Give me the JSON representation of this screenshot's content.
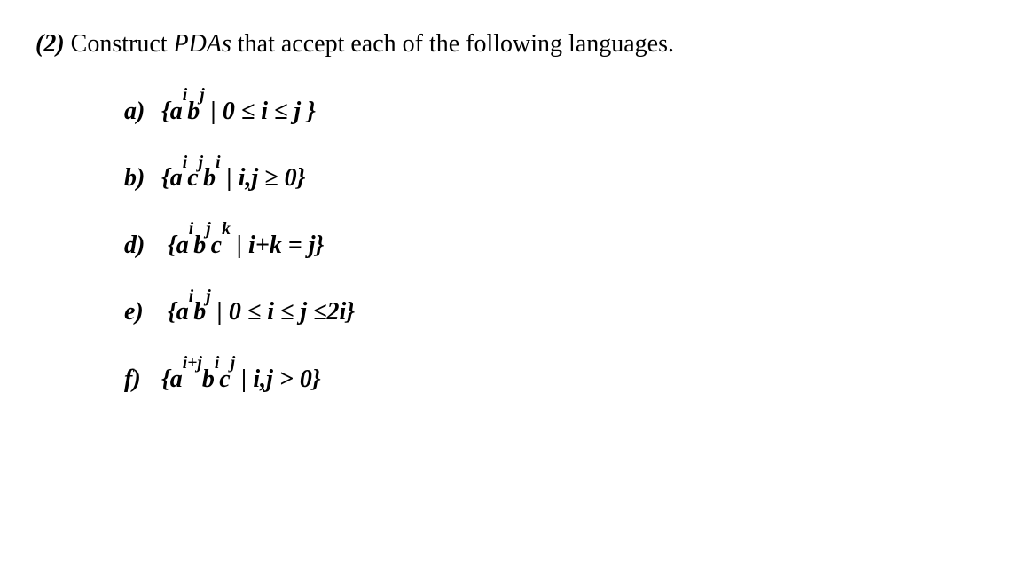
{
  "header": {
    "number": "(2)",
    "text_pre": " Construct ",
    "acronym": "PDAs",
    "text_post": " that accept each of the following languages."
  },
  "options": {
    "a": {
      "label": "a)",
      "base1": "a",
      "exp1": "i",
      "base2": "b",
      "exp2": "j",
      "condition": " | 0 ≤ i ≤ j }"
    },
    "b": {
      "label": "b)",
      "base1": "a",
      "exp1": "i",
      "base2": "c",
      "exp2": "j",
      "base3": "b",
      "exp3": "i",
      "condition": " | i,j ≥ 0}"
    },
    "d": {
      "label": "d)",
      "base1": "a",
      "exp1": "i",
      "base2": "b",
      "exp2": "j",
      "base3": "c",
      "exp3": "k",
      "condition": " | i+k = j}"
    },
    "e": {
      "label": "e)",
      "base1": "a",
      "exp1": "i",
      "base2": "b",
      "exp2": "j",
      "condition": " | 0 ≤ i ≤ j ≤2i}"
    },
    "f": {
      "label": "f)",
      "base1": "a",
      "exp1": "i+j",
      "base2": "b",
      "exp2": "i",
      "base3": "c",
      "exp3": "j",
      "condition": " | i,j > 0}"
    }
  },
  "open_brace": "{"
}
